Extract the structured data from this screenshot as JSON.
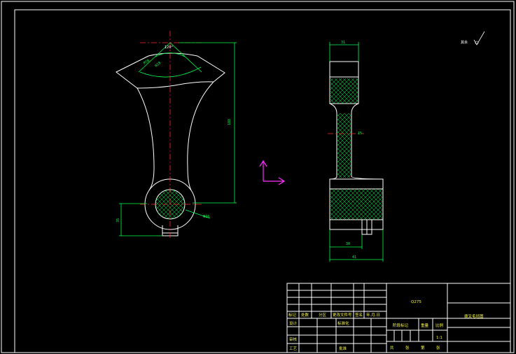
{
  "dimensions": {
    "front_height": "188",
    "front_angle": "120°",
    "front_r1": "R58",
    "front_r2": "R28",
    "front_small": "35",
    "front_dia": "Φ18",
    "side_top": "31",
    "side_web": "15",
    "side_bottom1": "30",
    "side_bottom2": "41"
  },
  "notes": {
    "roughness_label": "其余"
  },
  "title_block": {
    "material": "Q275",
    "drawing_name": "拨叉毛坯图",
    "row_labels": [
      "标记",
      "处数",
      "分区",
      "更改文件号",
      "签名",
      "年.月.日"
    ],
    "design_label": "设计",
    "standard_label": "标准化",
    "stage_label": "阶段标记",
    "weight_label": "重量",
    "scale_label": "比例",
    "scale_value": "1:1",
    "review_label": "审核",
    "process_label": "工艺",
    "approve_label": "批准",
    "sheet_text": [
      "共",
      "张",
      "第",
      "张"
    ]
  },
  "colors": {
    "background": "#000000",
    "outline": "#ffffff",
    "dimension": "#00ff4c",
    "centerline": "#ff2a2a",
    "ucs": "#ff30ff",
    "title_text": "#ffff40"
  }
}
